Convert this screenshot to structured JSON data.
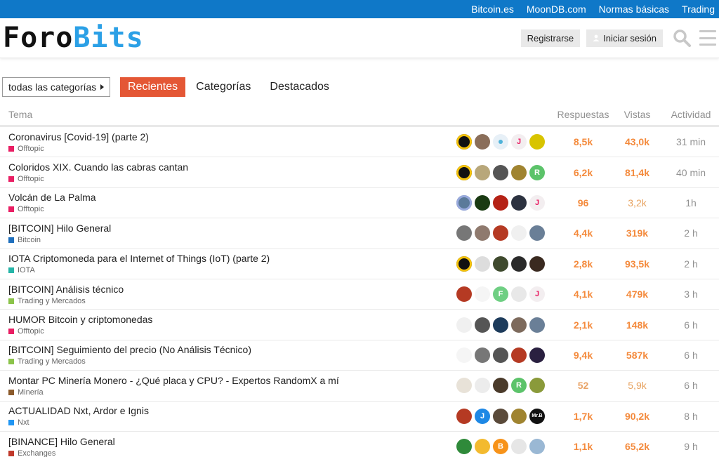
{
  "topbar": {
    "links": [
      "Bitcoin.es",
      "MoonDB.com",
      "Normas básicas",
      "Trading"
    ]
  },
  "header": {
    "logo_part1": "Foro",
    "logo_part2": "Bits",
    "register_label": "Registrarse",
    "login_label": "Iniciar sesión"
  },
  "nav": {
    "category_dropdown": "todas las categorías",
    "tabs": [
      "Recientes",
      "Categorías",
      "Destacados"
    ]
  },
  "table": {
    "headers": {
      "topic": "Tema",
      "replies": "Respuestas",
      "views": "Vistas",
      "activity": "Actividad"
    },
    "rows": [
      {
        "title": "Coronavirus [Covid-19] (parte 2)",
        "category": "Offtopic",
        "cat_color": "#e91e63",
        "replies": "8,5k",
        "views": "43,0k",
        "activity": "31 min",
        "avatars": [
          {
            "bg": "#111",
            "ring": "#f4c20d"
          },
          {
            "bg": "#8a6e5a"
          },
          {
            "bg": "#e7f0f7",
            "dot": "#4fb3d9"
          },
          {
            "bg": "#f3eef0",
            "letter": "J",
            "fg": "#e91e63"
          },
          {
            "bg": "#d8c400"
          }
        ]
      },
      {
        "title": "Coloridos XIX. Cuando las cabras cantan",
        "category": "Offtopic",
        "cat_color": "#e91e63",
        "replies": "6,2k",
        "views": "81,4k",
        "activity": "40 min",
        "avatars": [
          {
            "bg": "#111",
            "ring": "#f4c20d"
          },
          {
            "bg": "#b8a77a"
          },
          {
            "bg": "#555"
          },
          {
            "bg": "#a08430"
          },
          {
            "bg": "#5cc36a",
            "letter": "R",
            "fg": "#fff"
          }
        ]
      },
      {
        "title": "Volcán de La Palma",
        "category": "Offtopic",
        "cat_color": "#e91e63",
        "replies": "96",
        "views": "3,2k",
        "activity": "1h",
        "avatars": [
          {
            "bg": "#5b7a9a",
            "ring": "#9ad"
          },
          {
            "bg": "#1a3a12"
          },
          {
            "bg": "#b52216"
          },
          {
            "bg": "#2c3240"
          },
          {
            "bg": "#f3eef0",
            "letter": "J",
            "fg": "#e91e63"
          }
        ]
      },
      {
        "title": "[BITCOIN] Hilo General",
        "category": "Bitcoin",
        "cat_color": "#1e6fbd",
        "replies": "4,4k",
        "views": "319k",
        "activity": "2 h",
        "avatars": [
          {
            "bg": "#777"
          },
          {
            "bg": "#8f7a6e"
          },
          {
            "bg": "#b53a23"
          },
          {
            "bg": "#f0f0f0"
          },
          {
            "bg": "#6a7f97"
          }
        ]
      },
      {
        "title": "IOTA Criptomoneda para el Internet of Things (IoT) (parte 2)",
        "category": "IOTA",
        "cat_color": "#26b5a8",
        "replies": "2,8k",
        "views": "93,5k",
        "activity": "2 h",
        "avatars": [
          {
            "bg": "#111",
            "ring": "#f4c20d"
          },
          {
            "bg": "#ddd"
          },
          {
            "bg": "#3f4a2e"
          },
          {
            "bg": "#2a2a2a"
          },
          {
            "bg": "#3a2a20"
          }
        ]
      },
      {
        "title": "[BITCOIN] Análisis técnico",
        "category": "Trading y Mercados",
        "cat_color": "#8bc34a",
        "replies": "4,1k",
        "views": "479k",
        "activity": "3 h",
        "avatars": [
          {
            "bg": "#b53a23"
          },
          {
            "bg": "#f5f5f5"
          },
          {
            "bg": "#6fcf83",
            "letter": "F",
            "fg": "#fff"
          },
          {
            "bg": "#e8e8e8"
          },
          {
            "bg": "#f3eef0",
            "letter": "J",
            "fg": "#e91e63"
          }
        ]
      },
      {
        "title": "HUMOR Bitcoin y criptomonedas",
        "category": "Offtopic",
        "cat_color": "#e91e63",
        "replies": "2,1k",
        "views": "148k",
        "activity": "6 h",
        "avatars": [
          {
            "bg": "#f0f0f0"
          },
          {
            "bg": "#555"
          },
          {
            "bg": "#1d3b5b"
          },
          {
            "bg": "#7d6a5c"
          },
          {
            "bg": "#6a7f97"
          }
        ]
      },
      {
        "title": "[BITCOIN] Seguimiento del precio (No Análisis Técnico)",
        "category": "Trading y Mercados",
        "cat_color": "#8bc34a",
        "replies": "9,4k",
        "views": "587k",
        "activity": "6 h",
        "avatars": [
          {
            "bg": "#f5f5f5"
          },
          {
            "bg": "#777"
          },
          {
            "bg": "#555"
          },
          {
            "bg": "#b53a23"
          },
          {
            "bg": "#2a2040"
          }
        ]
      },
      {
        "title": "Montar PC Minería Monero - ¿Qué placa y CPU? - Expertos RandomX a mí",
        "category": "Minería",
        "cat_color": "#8b5a2b",
        "replies": "52",
        "views": "5,9k",
        "activity": "6 h",
        "avatars": [
          {
            "bg": "#e8e2d8"
          },
          {
            "bg": "#ececec"
          },
          {
            "bg": "#4a3a2a"
          },
          {
            "bg": "#5cc36a",
            "letter": "R",
            "fg": "#fff"
          },
          {
            "bg": "#8a9a3a"
          }
        ]
      },
      {
        "title": "ACTUALIDAD Nxt, Ardor e Ignis",
        "category": "Nxt",
        "cat_color": "#2196f3",
        "replies": "1,7k",
        "views": "90,2k",
        "activity": "8 h",
        "avatars": [
          {
            "bg": "#b53a23"
          },
          {
            "bg": "#1e88e5",
            "letter": "J",
            "fg": "#fff"
          },
          {
            "bg": "#5a4a3a"
          },
          {
            "bg": "#a08430"
          },
          {
            "bg": "#111",
            "letter": "Mr.B",
            "fg": "#fff"
          }
        ]
      },
      {
        "title": "[BINANCE] Hilo General",
        "category": "Exchanges",
        "cat_color": "#c0392b",
        "replies": "1,1k",
        "views": "65,2k",
        "activity": "9 h",
        "avatars": [
          {
            "bg": "#2f8a3a"
          },
          {
            "bg": "#f3ba2f"
          },
          {
            "bg": "#f7931a",
            "letter": "B",
            "fg": "#fff"
          },
          {
            "bg": "#e6e6e6"
          },
          {
            "bg": "#9ab8d4"
          }
        ]
      }
    ]
  }
}
